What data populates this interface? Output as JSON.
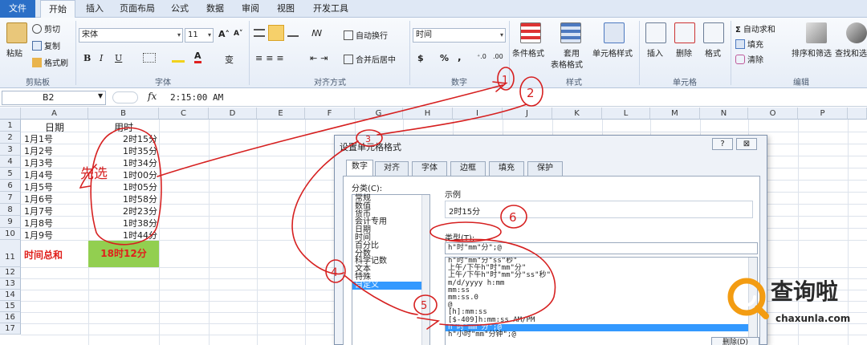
{
  "ribbon": {
    "tabs": [
      "文件",
      "开始",
      "插入",
      "页面布局",
      "公式",
      "数据",
      "审阅",
      "视图",
      "开发工具"
    ],
    "clipboard": {
      "paste": "粘贴",
      "cut": "剪切",
      "copy": "复制",
      "format_painter": "格式刷",
      "label": "剪贴板"
    },
    "font": {
      "name": "宋体",
      "size": "11",
      "bold": "B",
      "italic": "I",
      "underline": "U",
      "grow": "A˄",
      "shrink": "A˅",
      "phonetic": "变",
      "label": "字体"
    },
    "alignment": {
      "wrap": "自动换行",
      "merge": "合并后居中",
      "label": "对齐方式"
    },
    "number": {
      "format": "时间",
      "currency": "$",
      "percent": "%",
      "comma": ",",
      "label": "数字"
    },
    "styles": {
      "conditional": "条件格式",
      "table1": "套用",
      "table2": "表格格式",
      "cell_styles": "单元格样式",
      "label": "样式"
    },
    "cells": {
      "insert": "插入",
      "delete": "删除",
      "format": "格式",
      "label": "单元格"
    },
    "editing": {
      "autosum": "自动求和",
      "fill": "填充",
      "clear": "清除",
      "sort": "排序和筛选",
      "find": "查找和选",
      "label": "编辑"
    }
  },
  "formula_bar": {
    "name_box": "B2",
    "fx": "fx",
    "value": "2:15:00 AM"
  },
  "sheet": {
    "columns": [
      "A",
      "B",
      "C",
      "D",
      "E",
      "F",
      "G",
      "H",
      "I",
      "J",
      "K",
      "L",
      "M",
      "N",
      "O",
      "P"
    ],
    "rows": [
      "1",
      "2",
      "3",
      "4",
      "5",
      "6",
      "7",
      "8",
      "9",
      "10",
      "11",
      "12",
      "13",
      "14",
      "15",
      "16",
      "17"
    ],
    "header": {
      "a": "日期",
      "b": "用时"
    },
    "data": [
      {
        "a": "1月1号",
        "b": "2时15分"
      },
      {
        "a": "1月2号",
        "b": "1时35分"
      },
      {
        "a": "1月3号",
        "b": "1时34分"
      },
      {
        "a": "1月4号",
        "b": "1时00分"
      },
      {
        "a": "1月5号",
        "b": "1时05分"
      },
      {
        "a": "1月6号",
        "b": "1时58分"
      },
      {
        "a": "1月7号",
        "b": "2时23分"
      },
      {
        "a": "1月8号",
        "b": "1时38分"
      },
      {
        "a": "1月9号",
        "b": "1时44分"
      }
    ],
    "total_label": "时间总和",
    "total_value": "18时12分"
  },
  "dialog": {
    "title": "设置单元格格式",
    "help": "?",
    "close": "⊠",
    "tabs": [
      "数字",
      "对齐",
      "字体",
      "边框",
      "填充",
      "保护"
    ],
    "category_label": "分类(C):",
    "categories": [
      "常规",
      "数值",
      "货币",
      "会计专用",
      "日期",
      "时间",
      "百分比",
      "分数",
      "科学记数",
      "文本",
      "特殊",
      "自定义"
    ],
    "sample_label": "示例",
    "sample_value": "2时15分",
    "type_label": "类型(T):",
    "type_value": "h\"时\"mm\"分\";@",
    "formats": [
      "h\"时\"mm\"分\"ss\"秒\"",
      "上午/下午h\"时\"mm\"分\"",
      "上午/下午h\"时\"mm\"分\"ss\"秒\"",
      "m/d/yyyy h:mm",
      "mm:ss",
      "mm:ss.0",
      "@",
      "[h]:mm:ss",
      "[$-409]h:mm:ss AM/PM",
      "h\"时\"mm\"分\";@",
      "h\"小时\"mm\"分钟\";@"
    ],
    "delete_button": "删除(D)"
  },
  "annotations": {
    "hand_text": "先选",
    "marks": [
      "1",
      "2",
      "3",
      "4",
      "5",
      "6"
    ]
  },
  "watermark": {
    "name": "查询啦",
    "domain": "chaxunla.com"
  }
}
